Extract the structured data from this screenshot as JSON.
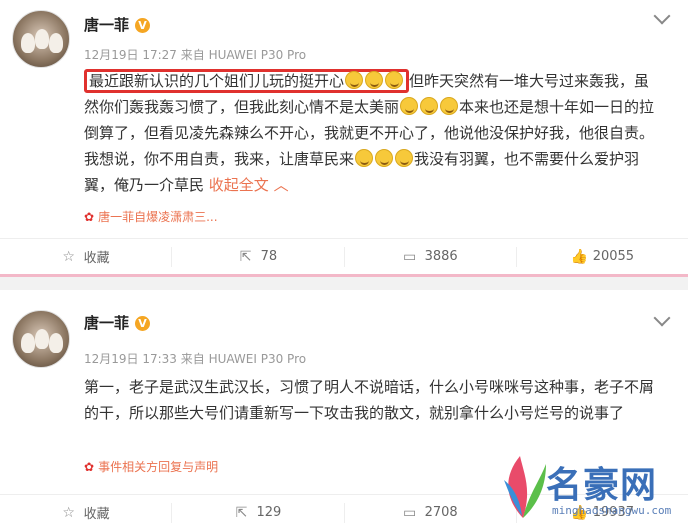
{
  "posts": [
    {
      "author": "唐一菲",
      "badge": "V",
      "meta": "12月19日 17:27 来自 HUAWEI P30 Pro",
      "highlighted_text": "最近跟新认识的几个姐们儿玩的挺开心",
      "text_part1": "但昨天突然有一堆大号过来轰我，虽然你们轰我轰习惯了，但我此刻心情不是太美丽",
      "text_part2": "本来也还是想十年如一日的拉倒算了，但看见凌先森辣么不开心，我就更不开心了，他说他没保护好我，他很自责。我想说，你不用自责，我来，让唐草民来",
      "text_part3": "我没有羽翼，也不需要什么爱护羽翼，俺乃一介草民",
      "collapse_label": "收起全文",
      "topic": "唐一菲自爆凌潇肃三...",
      "actions": {
        "collect": "收藏",
        "repost": "78",
        "comment": "3886",
        "like": "20055"
      }
    },
    {
      "author": "唐一菲",
      "badge": "V",
      "meta": "12月19日 17:33 来自 HUAWEI P30 Pro",
      "text": "第一，老子是武汉生武汉长，习惯了明人不说暗话，什么小号咪咪号这种事，老子不屑的干，所以那些大号们请重新写一下攻击我的散文，就别拿什么小号烂号的说事了",
      "topic": "事件相关方回复与声明",
      "actions": {
        "collect": "收藏",
        "repost": "129",
        "comment": "2708",
        "like": "19937"
      }
    }
  ],
  "watermark": {
    "title": "名豪网",
    "url": "minghaoshangwu.com"
  },
  "colors": {
    "link": "#eb7350",
    "highlight_border": "#e0312e",
    "verified": "#f5a623"
  }
}
